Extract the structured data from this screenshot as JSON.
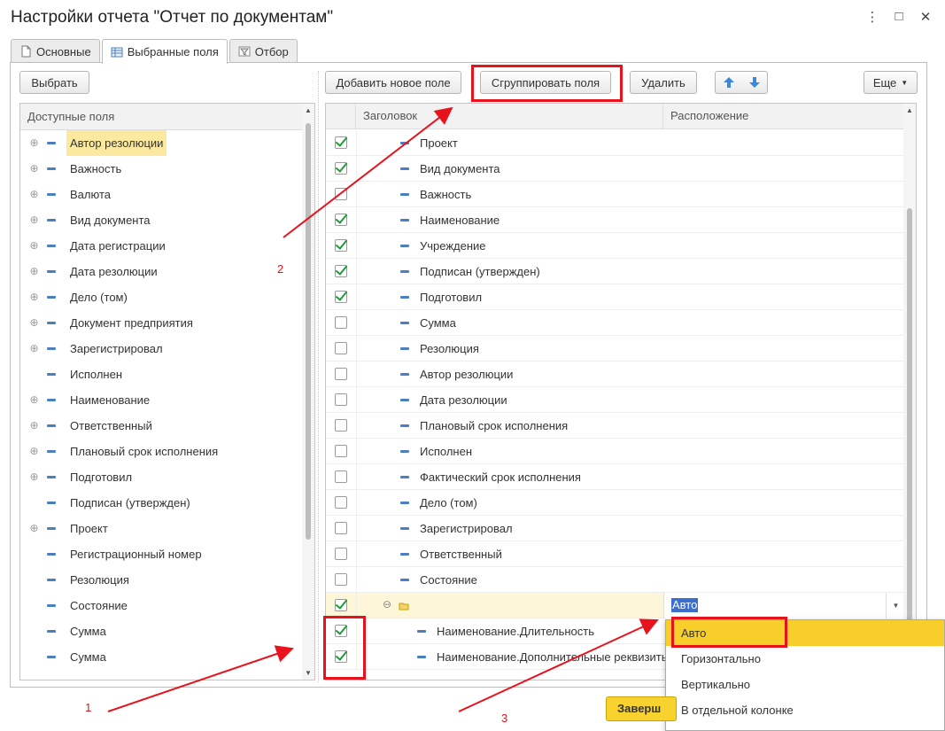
{
  "window": {
    "title": "Настройки отчета \"Отчет по документам\"",
    "menu_glyph": "⋮",
    "maximize_glyph": "□",
    "close_glyph": "✕"
  },
  "tabs": [
    {
      "label": "Основные",
      "icon": "document-icon"
    },
    {
      "label": "Выбранные поля",
      "icon": "table-icon",
      "active": true
    },
    {
      "label": "Отбор",
      "icon": "filter-icon"
    }
  ],
  "left": {
    "select_button": "Выбрать",
    "header": "Доступные поля",
    "items": [
      {
        "label": "Автор резолюции",
        "expandable": true,
        "highlighted": true
      },
      {
        "label": "Важность",
        "expandable": true
      },
      {
        "label": "Валюта",
        "expandable": true
      },
      {
        "label": "Вид документа",
        "expandable": true
      },
      {
        "label": "Дата регистрации",
        "expandable": true
      },
      {
        "label": "Дата резолюции",
        "expandable": true
      },
      {
        "label": "Дело (том)",
        "expandable": true
      },
      {
        "label": "Документ предприятия",
        "expandable": true
      },
      {
        "label": "Зарегистрировал",
        "expandable": true
      },
      {
        "label": "Исполнен",
        "expandable": false
      },
      {
        "label": "Наименование",
        "expandable": true
      },
      {
        "label": "Ответственный",
        "expandable": true
      },
      {
        "label": "Плановый срок исполнения",
        "expandable": true
      },
      {
        "label": "Подготовил",
        "expandable": true
      },
      {
        "label": "Подписан (утвержден)",
        "expandable": false
      },
      {
        "label": "Проект",
        "expandable": true
      },
      {
        "label": "Регистрационный номер",
        "expandable": false
      },
      {
        "label": "Резолюция",
        "expandable": false
      },
      {
        "label": "Состояние",
        "expandable": false
      },
      {
        "label": "Сумма",
        "expandable": false
      },
      {
        "label": "Сумма",
        "expandable": false
      }
    ]
  },
  "toolbar": {
    "add_field": "Добавить новое поле",
    "group_fields": "Сгруппировать поля",
    "delete": "Удалить",
    "more": "Еще"
  },
  "grid": {
    "col_title": "Заголовок",
    "col_location": "Расположение",
    "rows": [
      {
        "checked": true,
        "label": "Проект"
      },
      {
        "checked": true,
        "label": "Вид документа"
      },
      {
        "checked": false,
        "label": "Важность"
      },
      {
        "checked": true,
        "label": "Наименование"
      },
      {
        "checked": true,
        "label": "Учреждение"
      },
      {
        "checked": true,
        "label": "Подписан (утвержден)"
      },
      {
        "checked": true,
        "label": "Подготовил"
      },
      {
        "checked": false,
        "label": "Сумма"
      },
      {
        "checked": false,
        "label": "Резолюция"
      },
      {
        "checked": false,
        "label": "Автор резолюции"
      },
      {
        "checked": false,
        "label": "Дата резолюции"
      },
      {
        "checked": false,
        "label": "Плановый срок исполнения"
      },
      {
        "checked": false,
        "label": "Исполнен"
      },
      {
        "checked": false,
        "label": "Фактический срок исполнения"
      },
      {
        "checked": false,
        "label": "Дело (том)"
      },
      {
        "checked": false,
        "label": "Зарегистрировал"
      },
      {
        "checked": false,
        "label": "Ответственный"
      },
      {
        "checked": false,
        "label": "Состояние"
      }
    ],
    "group_row": {
      "checked": true,
      "location": "Авто"
    },
    "children": [
      {
        "checked": true,
        "label": "Наименование.Длительность"
      },
      {
        "checked": true,
        "label": "Наименование.Дополнительные реквизиты"
      }
    ]
  },
  "dropdown": {
    "options": [
      "Авто",
      "Горизонтально",
      "Вертикально",
      "В отдельной колонке"
    ],
    "selected": "Авто"
  },
  "footer": {
    "finish_button": "Заверш"
  },
  "annotations": {
    "label1": "1",
    "label2": "2",
    "label3": "3",
    "color": "#e8121c"
  }
}
